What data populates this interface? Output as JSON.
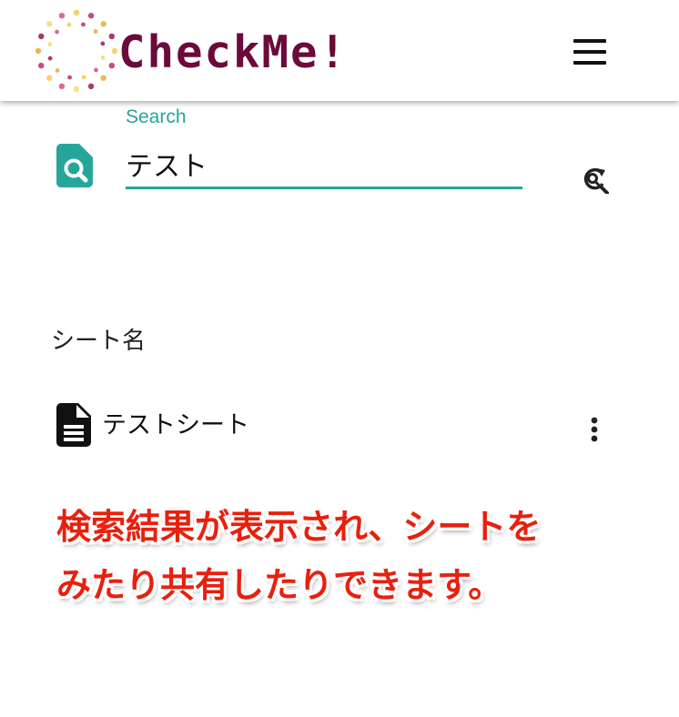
{
  "header": {
    "logo_text": "CheckMe!",
    "menu_icon": "hamburger-menu-icon"
  },
  "search": {
    "label": "Search",
    "value": "テスト",
    "doc_icon": "document-search-icon",
    "refresh_icon": "refresh-search-icon"
  },
  "results": {
    "section_label": "シート名",
    "items": [
      {
        "name": "テストシート",
        "icon": "document-icon",
        "menu_icon": "more-vertical-icon"
      }
    ]
  },
  "annotation": {
    "line1": "検索結果が表示され、シートを",
    "line2": "みたり共有したりできます。"
  },
  "colors": {
    "accent": "#26a69a",
    "logo_text": "#6b0a3b",
    "annotation": "#e8200e"
  }
}
